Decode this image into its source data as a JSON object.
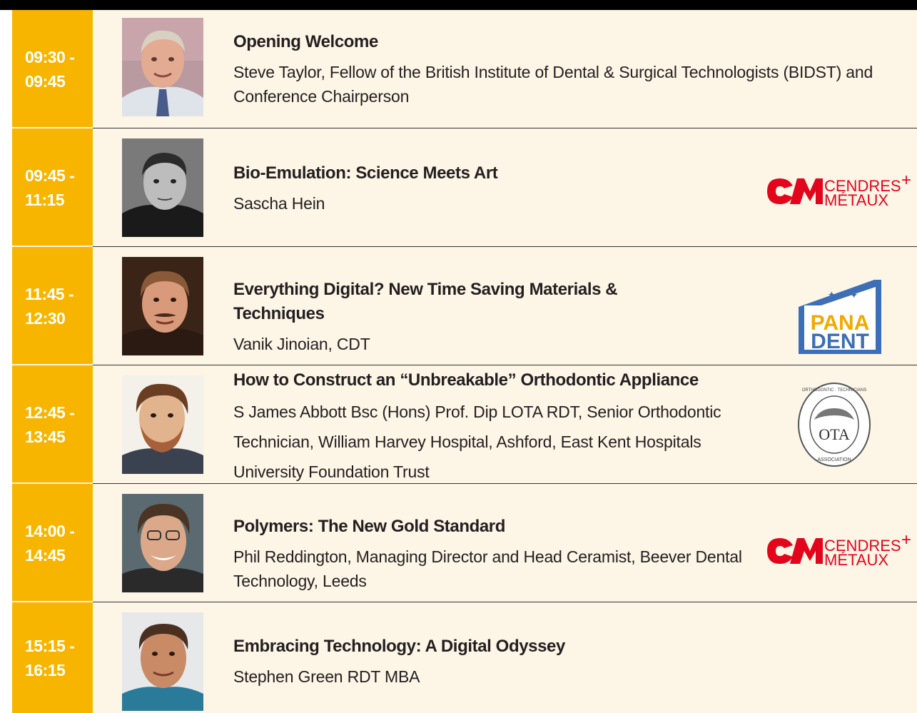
{
  "sessions": [
    {
      "time_start": "09:30 -",
      "time_end": "09:45",
      "title": "Opening Welcome",
      "speaker": "Steve Taylor, Fellow of the British Institute of Dental & Surgical Technologists (BIDST) and Conference Chairperson",
      "logo": ""
    },
    {
      "time_start": "09:45 -",
      "time_end": "11:15",
      "title": "Bio-Emulation: Science Meets Art",
      "speaker": "Sascha Hein",
      "logo": "cendres-metaux"
    },
    {
      "time_start": "11:45 -",
      "time_end": "12:30",
      "title": "Everything Digital? New Time Saving Materials & Techniques",
      "speaker": "Vanik Jinoian, CDT",
      "logo": "panadent"
    },
    {
      "time_start": "12:45 -",
      "time_end": "13:45",
      "title": "How to Construct an “Unbreakable” Orthodontic Appliance",
      "speaker": "S James Abbott Bsc (Hons) Prof. Dip LOTA RDT, Senior Orthodontic Technician, William Harvey Hospital, Ashford, East Kent Hospitals University Foundation Trust",
      "logo": "ota"
    },
    {
      "time_start": "14:00 -",
      "time_end": "14:45",
      "title": "Polymers: The New Gold Standard",
      "speaker": "Phil Reddington, Managing Director and Head Ceramist, Beever Dental Technology, Leeds",
      "logo": "cendres-metaux"
    },
    {
      "time_start": "15:15 -",
      "time_end": "16:15",
      "title": "Embracing Technology: A Digital Odyssey",
      "speaker": "Stephen Green RDT MBA",
      "logo": ""
    }
  ],
  "logos": {
    "cendres": {
      "line1": "CENDRES",
      "line2": "MÉTAUX",
      "plus": "+"
    },
    "panadent": {
      "line1": "PANA",
      "line2": "DENT"
    },
    "ota": {
      "center": "OTA",
      "ring_top": "ORTHODONTIC · TECHNICIANS",
      "ring_bottom": "ASSOCIATION"
    }
  },
  "colors": {
    "time_bg": "#f7b500",
    "page_bg": "#fdf5e6",
    "text": "#231f20",
    "cendres_red": "#e3051b",
    "panadent_blue": "#3d6fb6"
  }
}
